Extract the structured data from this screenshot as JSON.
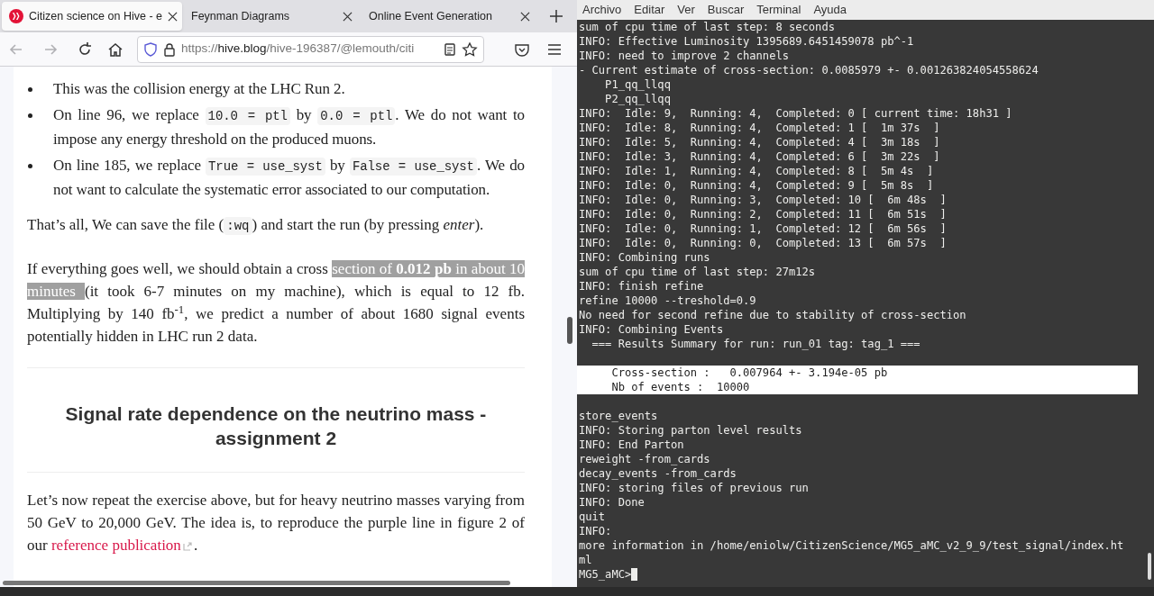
{
  "browser": {
    "tabs": [
      {
        "title": "Citizen science on Hive - e",
        "selected": true
      },
      {
        "title": "Feynman Diagrams",
        "selected": false
      },
      {
        "title": "Online Event Generation",
        "selected": false
      }
    ],
    "url": {
      "prefix": "https://",
      "host": "hive.blog",
      "path": "/hive-196387/@lemouth/citi"
    }
  },
  "article": {
    "bullets": [
      {
        "parts": [
          {
            "kind": "text",
            "text": "This was the collision energy at the LHC Run 2."
          }
        ]
      },
      {
        "parts": [
          {
            "kind": "text",
            "text": "On line 96, we replace "
          },
          {
            "kind": "code",
            "text": "10.0 = ptl"
          },
          {
            "kind": "text",
            "text": " by "
          },
          {
            "kind": "code",
            "text": "0.0 = ptl"
          },
          {
            "kind": "text",
            "text": ". We do not want to impose any energy threshold on the produced muons."
          }
        ]
      },
      {
        "parts": [
          {
            "kind": "text",
            "text": "On line 185, we replace "
          },
          {
            "kind": "code",
            "text": "True = use_syst"
          },
          {
            "kind": "text",
            "text": " by "
          },
          {
            "kind": "code",
            "text": "False = use_syst"
          },
          {
            "kind": "text",
            "text": ". We do not want to calculate the systematic error associated to our computation."
          }
        ]
      }
    ],
    "para1": [
      {
        "kind": "text",
        "text": "That’s all, We can save the file ("
      },
      {
        "kind": "code",
        "text": ":wq"
      },
      {
        "kind": "text",
        "text": ") and start the run (by pressing *enter*)."
      }
    ],
    "para2": [
      {
        "kind": "text",
        "text": "If everything goes well, we should obtain a cross "
      },
      {
        "kind": "selected",
        "text": "section of **0.012 pb** in about 10 minutes "
      },
      {
        "kind": "text",
        "text": "(it took 6-7 minutes on my machine), which is equal to 12 fb. Multiplying by 140 fb$^{-1}$, we predict a number of about 1680 signal events potentially hidden in LHC run 2 data."
      }
    ],
    "heading": "Signal rate dependence on the neutrino mass - assignment 2",
    "para3": "Let’s now repeat the exercise above, but for heavy neutrino masses varying from 50 GeV to 20,000 GeV. The idea is, to reproduce the purple line in figure 2 of our ",
    "link": "reference publication",
    "para3_end": "."
  },
  "terminal": {
    "menu": [
      "Archivo",
      "Editar",
      "Ver",
      "Buscar",
      "Terminal",
      "Ayuda"
    ],
    "lines": [
      {
        "kind": "text",
        "text": "sum of cpu time of last step: 8 seconds",
        "selected": false
      },
      {
        "kind": "text",
        "text": "INFO: Effective Luminosity 1395689.6451459078 pb^-1",
        "selected": false
      },
      {
        "kind": "text",
        "text": "INFO: need to improve 2 channels",
        "selected": false
      },
      {
        "kind": "text",
        "text": "- Current estimate of cross-section: 0.0085979 +- 0.001263824054558624",
        "selected": false
      },
      {
        "kind": "text",
        "text": "    P1_qq_llqq",
        "selected": false
      },
      {
        "kind": "text",
        "text": "    P2_qq_llqq",
        "selected": false
      },
      {
        "kind": "text",
        "text": "INFO:  Idle: 9,  Running: 4,  Completed: 0 [ current time: 18h31 ]",
        "selected": false
      },
      {
        "kind": "text",
        "text": "INFO:  Idle: 8,  Running: 4,  Completed: 1 [  1m 37s  ]",
        "selected": false
      },
      {
        "kind": "text",
        "text": "INFO:  Idle: 5,  Running: 4,  Completed: 4 [  3m 18s  ]",
        "selected": false
      },
      {
        "kind": "text",
        "text": "INFO:  Idle: 3,  Running: 4,  Completed: 6 [  3m 22s  ]",
        "selected": false
      },
      {
        "kind": "text",
        "text": "INFO:  Idle: 1,  Running: 4,  Completed: 8 [  5m 4s  ]",
        "selected": false
      },
      {
        "kind": "text",
        "text": "INFO:  Idle: 0,  Running: 4,  Completed: 9 [  5m 8s  ]",
        "selected": false
      },
      {
        "kind": "text",
        "text": "INFO:  Idle: 0,  Running: 3,  Completed: 10 [  6m 48s  ]",
        "selected": false
      },
      {
        "kind": "text",
        "text": "INFO:  Idle: 0,  Running: 2,  Completed: 11 [  6m 51s  ]",
        "selected": false
      },
      {
        "kind": "text",
        "text": "INFO:  Idle: 0,  Running: 1,  Completed: 12 [  6m 56s  ]",
        "selected": false
      },
      {
        "kind": "text",
        "text": "INFO:  Idle: 0,  Running: 0,  Completed: 13 [  6m 57s  ]",
        "selected": false
      },
      {
        "kind": "text",
        "text": "INFO: Combining runs",
        "selected": false
      },
      {
        "kind": "text",
        "text": "sum of cpu time of last step: 27m12s",
        "selected": false
      },
      {
        "kind": "text",
        "text": "INFO: finish refine",
        "selected": false
      },
      {
        "kind": "text",
        "text": "refine 10000 --treshold=0.9",
        "selected": false
      },
      {
        "kind": "text",
        "text": "No need for second refine due to stability of cross-section",
        "selected": false
      },
      {
        "kind": "text",
        "text": "INFO: Combining Events",
        "selected": false
      },
      {
        "kind": "text",
        "text": "  === Results Summary for run: run_01 tag: tag_1 ===",
        "selected": false
      },
      {
        "kind": "blank"
      },
      {
        "kind": "text",
        "text": "     Cross-section :   0.007964 +- 3.194e-05 pb",
        "selected": true
      },
      {
        "kind": "text",
        "text": "     Nb of events :  10000",
        "selected": true
      },
      {
        "kind": "blank"
      },
      {
        "kind": "text",
        "text": "store_events",
        "selected": false
      },
      {
        "kind": "text",
        "text": "INFO: Storing parton level results",
        "selected": false
      },
      {
        "kind": "text",
        "text": "INFO: End Parton",
        "selected": false
      },
      {
        "kind": "text",
        "text": "reweight -from_cards",
        "selected": false
      },
      {
        "kind": "text",
        "text": "decay_events -from_cards",
        "selected": false
      },
      {
        "kind": "text",
        "text": "INFO: storing files of previous run",
        "selected": false
      },
      {
        "kind": "text",
        "text": "INFO: Done",
        "selected": false
      },
      {
        "kind": "text",
        "text": "quit",
        "selected": false
      },
      {
        "kind": "text",
        "text": "INFO:",
        "selected": false
      },
      {
        "kind": "text",
        "text": "more information in /home/eniolw/CitizenScience/MG5_aMC_v2_9_9/test_signal/index.ht",
        "selected": false
      },
      {
        "kind": "text",
        "text": "ml",
        "selected": false
      },
      {
        "kind": "prompt",
        "text": "MG5_aMC>"
      }
    ]
  }
}
